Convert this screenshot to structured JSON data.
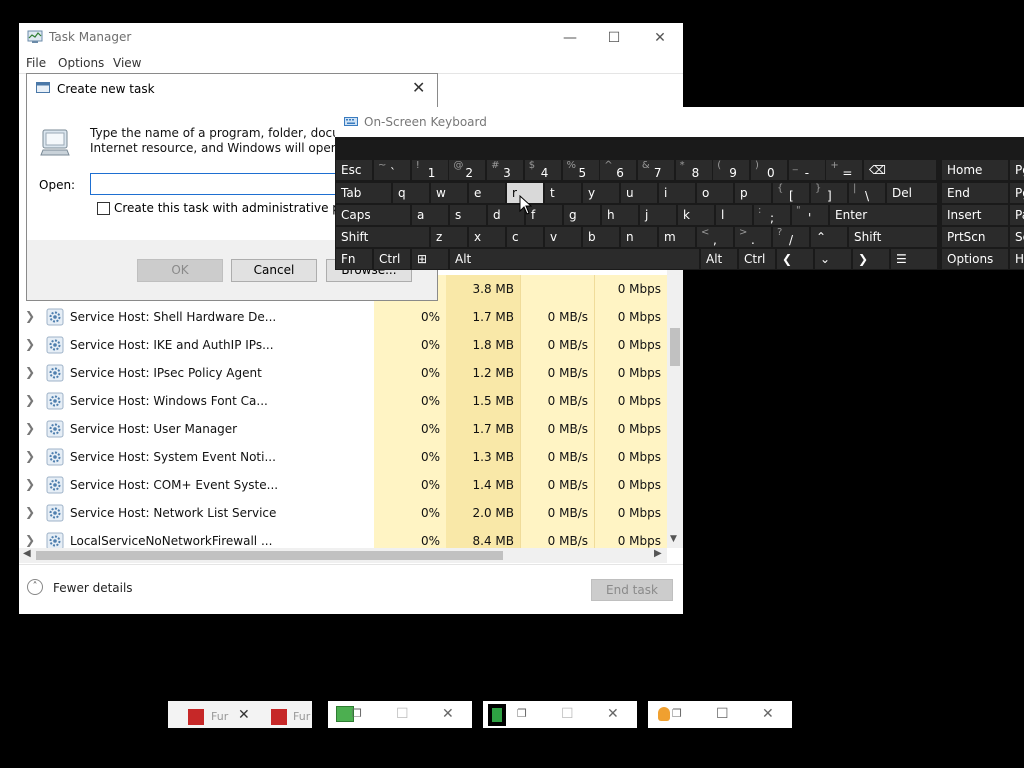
{
  "task_manager": {
    "title": "Task Manager",
    "menu": [
      "File",
      "Options",
      "View"
    ],
    "rows": [
      {
        "name": "",
        "cpu": "",
        "mem": "3.8 MB",
        "disk": "",
        "net": "0 Mbps"
      },
      {
        "name": "Service Host: Shell Hardware De...",
        "cpu": "0%",
        "mem": "1.7 MB",
        "disk": "0 MB/s",
        "net": "0 Mbps"
      },
      {
        "name": "Service Host: IKE and AuthIP IPs...",
        "cpu": "0%",
        "mem": "1.8 MB",
        "disk": "0 MB/s",
        "net": "0 Mbps"
      },
      {
        "name": "Service Host: IPsec Policy Agent",
        "cpu": "0%",
        "mem": "1.2 MB",
        "disk": "0 MB/s",
        "net": "0 Mbps"
      },
      {
        "name": "Service Host: Windows Font Ca...",
        "cpu": "0%",
        "mem": "1.5 MB",
        "disk": "0 MB/s",
        "net": "0 Mbps"
      },
      {
        "name": "Service Host: User Manager",
        "cpu": "0%",
        "mem": "1.7 MB",
        "disk": "0 MB/s",
        "net": "0 Mbps"
      },
      {
        "name": "Service Host: System Event Noti...",
        "cpu": "0%",
        "mem": "1.3 MB",
        "disk": "0 MB/s",
        "net": "0 Mbps"
      },
      {
        "name": "Service Host: COM+ Event Syste...",
        "cpu": "0%",
        "mem": "1.4 MB",
        "disk": "0 MB/s",
        "net": "0 Mbps"
      },
      {
        "name": "Service Host: Network List Service",
        "cpu": "0%",
        "mem": "2.0 MB",
        "disk": "0 MB/s",
        "net": "0 Mbps"
      },
      {
        "name": "LocalServiceNoNetworkFirewall ...",
        "cpu": "0%",
        "mem": "8.4 MB",
        "disk": "0 MB/s",
        "net": "0 Mbps"
      }
    ],
    "fewer_details": "Fewer details",
    "end_task": "End task"
  },
  "dialog": {
    "title": "Create new task",
    "message": "Type the name of a program, folder, document, or Internet resource, and Windows will open it for you.",
    "open_label": "Open:",
    "open_value": "",
    "admin_checkbox": "Create this task with administrative privileges.",
    "ok": "OK",
    "cancel": "Cancel",
    "browse": "Browse..."
  },
  "osk": {
    "title": "On-Screen Keyboard",
    "keys": {
      "esc": "Esc",
      "tab": "Tab",
      "caps": "Caps",
      "shift": "Shift",
      "fn": "Fn",
      "ctrl": "Ctrl",
      "alt": "Alt",
      "del": "Del",
      "enter": "Enter",
      "home": "Home",
      "end": "End",
      "insert": "Insert",
      "prtscn": "PrtScn",
      "options": "Options",
      "pg": "Pg",
      "sc": "Sc",
      "pa": "Pa",
      "h": "H"
    },
    "row1": [
      [
        "~",
        "`"
      ],
      [
        "!",
        "1"
      ],
      [
        "@",
        "2"
      ],
      [
        "#",
        "3"
      ],
      [
        "$",
        "4"
      ],
      [
        "%",
        "5"
      ],
      [
        "^",
        "6"
      ],
      [
        "&",
        "7"
      ],
      [
        "*",
        "8"
      ],
      [
        "(",
        "9"
      ],
      [
        ")",
        "0"
      ],
      [
        "_",
        "-"
      ],
      [
        "+",
        "="
      ]
    ],
    "row2": [
      "q",
      "w",
      "e",
      "r",
      "t",
      "y",
      "u",
      "i",
      "o",
      "p"
    ],
    "row2_brackets": [
      [
        "{",
        "["
      ],
      [
        "}",
        "]"
      ],
      [
        "|",
        "\\"
      ]
    ],
    "row3": [
      "a",
      "s",
      "d",
      "f",
      "g",
      "h",
      "j",
      "k",
      "l"
    ],
    "row3_punct": [
      [
        ":",
        ";"
      ],
      [
        "\"",
        "'"
      ]
    ],
    "row4": [
      "z",
      "x",
      "c",
      "v",
      "b",
      "n",
      "m"
    ],
    "row4_punct": [
      [
        "<",
        ","
      ],
      [
        ">",
        "."
      ],
      [
        "?",
        "/"
      ]
    ]
  },
  "taskbar": {
    "thumb1_labels": [
      "Fur",
      "Fur"
    ]
  }
}
